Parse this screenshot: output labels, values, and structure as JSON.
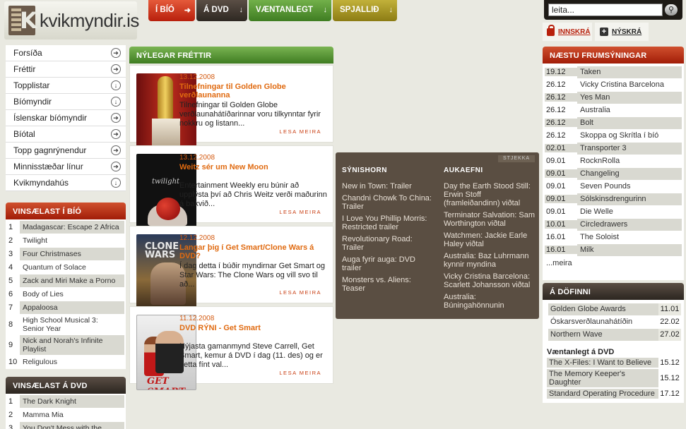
{
  "header": {
    "logo_text": "kvikmyndir.is",
    "nav": [
      {
        "label": "Í BÍÓ"
      },
      {
        "label": "Á DVD"
      },
      {
        "label": "VÆNTANLEGT"
      },
      {
        "label": "SPJALLIÐ"
      }
    ],
    "search_value": "leita...",
    "login_label": "INNSKRÁ",
    "register_label": "NÝSKRÁ"
  },
  "leftnav": {
    "items": [
      {
        "label": "Forsíða",
        "arrow": "➔"
      },
      {
        "label": "Fréttir",
        "arrow": "➔"
      },
      {
        "label": "Topplistar",
        "arrow": "↓"
      },
      {
        "label": "Bíómyndir",
        "arrow": "↓"
      },
      {
        "label": "Íslenskar bíómyndir",
        "arrow": "➔"
      },
      {
        "label": "Bíótal",
        "arrow": "➔"
      },
      {
        "label": "Topp gagnrýnendur",
        "arrow": "➔"
      },
      {
        "label": "Minnisstæðar línur",
        "arrow": "➔"
      },
      {
        "label": "Kvikmyndahús",
        "arrow": "↓"
      }
    ]
  },
  "vinsaelast_bio": {
    "title": "VINSÆLAST Í BÍÓ",
    "items": [
      {
        "num": "1",
        "title": "Madagascar: Escape 2 Africa"
      },
      {
        "num": "2",
        "title": "Twilight"
      },
      {
        "num": "3",
        "title": "Four Christmases"
      },
      {
        "num": "4",
        "title": "Quantum of Solace"
      },
      {
        "num": "5",
        "title": "Zack and Miri Make a Porno"
      },
      {
        "num": "6",
        "title": "Body of Lies"
      },
      {
        "num": "7",
        "title": "Appaloosa"
      },
      {
        "num": "8",
        "title": "High School Musical 3: Senior Year"
      },
      {
        "num": "9",
        "title": "Nick and Norah's Infinite Playlist"
      },
      {
        "num": "10",
        "title": "Religulous"
      }
    ]
  },
  "vinsaelast_dvd": {
    "title": "VINSÆLAST Á DVD",
    "items": [
      {
        "num": "1",
        "title": "The Dark Knight"
      },
      {
        "num": "2",
        "title": "Mamma Mia"
      },
      {
        "num": "3",
        "title": "You Don't Mess with the"
      }
    ]
  },
  "news": {
    "title": "NÝLEGAR FRÉTTIR",
    "more_label": "LESA MEIRA",
    "items": [
      {
        "date": "13.12.2008",
        "title": "Tilnefningar til Golden Globe verðlaunanna",
        "body": "Tilnefningar til Golden Globe verðlaunahátíðarinnar voru tilkynntar fyrir nokkru og listann..."
      },
      {
        "date": "13.12.2008",
        "title": "Weitz sér um New Moon",
        "body": "Entertainment Weekly eru búnir að upplýsta því að Chris Weitz verði maðurinn á bakvið..."
      },
      {
        "date": "12.12.2008",
        "title": "Langar þig í Get Smart/Clone Wars á DVD?",
        "body": "Í dag detta í búðir myndirnar Get Smart og Star Wars: The Clone Wars og vill svo til að..."
      },
      {
        "date": "11.12.2008",
        "title": "DVD RÝNI - Get Smart",
        "body": "Nýjasta gamanmynd Steve Carrell, Get Smart, kemur á DVD í dag (11. des) og er þetta fínt val..."
      }
    ]
  },
  "darkpanel": {
    "stjekka": "STJEKKA",
    "synishorn_title": "SÝNISHORN",
    "synishorn": [
      "New in Town: Trailer",
      "Chandni Chowk To China: Trailer",
      "I Love You Phillip Morris: Restricted trailer",
      "Revolutionary Road: Trailer",
      "Auga fyrir auga: DVD trailer",
      "Monsters vs. Aliens: Teaser"
    ],
    "aukaefni_title": "AUKAEFNI",
    "aukaefni": [
      "Day the Earth Stood Still: Erwin Stoff (framleiðandinn) viðtal",
      "Terminator Salvation: Sam Worthington viðtal",
      "Watchmen: Jackie Earle Haley viðtal",
      "Australia: Baz Luhrmann kynnir myndina",
      "Vicky Cristina Barcelona: Scarlett Johansson viðtal",
      "Australia: Búningahönnunin"
    ]
  },
  "frumsyningar": {
    "title": "NÆSTU FRUMSÝNINGAR",
    "more": "...meira",
    "items": [
      {
        "date": "19.12",
        "title": "Taken"
      },
      {
        "date": "26.12",
        "title": "Vicky Cristina Barcelona"
      },
      {
        "date": "26.12",
        "title": "Yes Man"
      },
      {
        "date": "26.12",
        "title": "Australia"
      },
      {
        "date": "26.12",
        "title": "Bolt"
      },
      {
        "date": "26.12",
        "title": "Skoppa og Skrítla í bíó"
      },
      {
        "date": "02.01",
        "title": "Transporter 3"
      },
      {
        "date": "09.01",
        "title": "RocknRolla"
      },
      {
        "date": "09.01",
        "title": "Changeling"
      },
      {
        "date": "09.01",
        "title": "Seven Pounds"
      },
      {
        "date": "09.01",
        "title": "Sólskinsdrengurinn"
      },
      {
        "date": "09.01",
        "title": "Die Welle"
      },
      {
        "date": "10.01",
        "title": "Circledrawers"
      },
      {
        "date": "16.01",
        "title": "The Soloist"
      },
      {
        "date": "16.01",
        "title": "Milk"
      }
    ]
  },
  "dofinni": {
    "title": "Á DÖFINNI",
    "items": [
      {
        "title": "Golden Globe Awards",
        "date": "11.01"
      },
      {
        "title": "Óskarsverðlaunahátíðin",
        "date": "22.02"
      },
      {
        "title": "Northern Wave",
        "date": "27.02"
      }
    ],
    "vdvd_title": "Væntanlegt á DVD",
    "vdvd": [
      {
        "title": "The X-Files: I Want to Believe",
        "date": "15.12"
      },
      {
        "title": "The Memory Keeper's Daughter",
        "date": "15.12"
      },
      {
        "title": "Standard Operating Procedure",
        "date": "17.12"
      }
    ]
  }
}
